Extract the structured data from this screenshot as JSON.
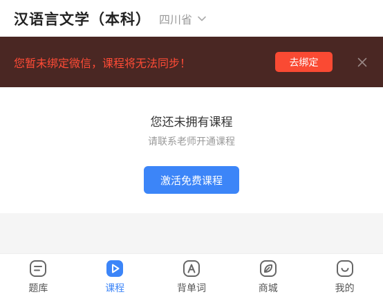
{
  "header": {
    "course_title": "汉语言文学（本科）",
    "province": "四川省",
    "chevron_icon": "chevron-down-icon"
  },
  "banner": {
    "message": "您暂未绑定微信，课程将无法同步！",
    "bind_label": "去绑定",
    "close_icon": "close-icon",
    "background": "#4a2723",
    "text_color": "#ff4b36",
    "button_color": "#fa4a33"
  },
  "empty_state": {
    "title": "您还未拥有课程",
    "subtitle": "请联系老师开通课程",
    "activate_label": "激活免费课程",
    "button_color": "#3c85f8"
  },
  "tabbar": {
    "items": [
      {
        "label": "题库",
        "icon": "question-bank-icon",
        "active": false
      },
      {
        "label": "课程",
        "icon": "play-icon",
        "active": true
      },
      {
        "label": "背单词",
        "icon": "vocabulary-icon",
        "active": false
      },
      {
        "label": "商城",
        "icon": "shop-icon",
        "active": false
      },
      {
        "label": "我的",
        "icon": "profile-icon",
        "active": false
      }
    ],
    "active_color": "#3c85f8"
  }
}
